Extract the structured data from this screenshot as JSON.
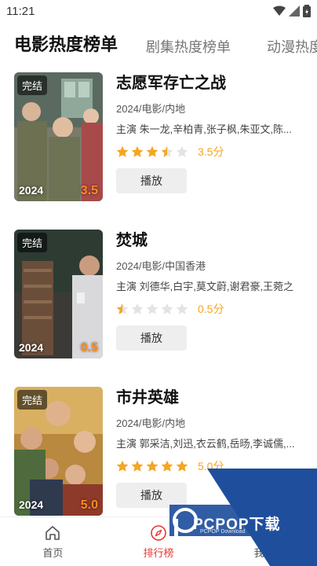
{
  "status_bar": {
    "time": "11:21"
  },
  "tabs": [
    {
      "label": "电影热度榜单",
      "active": true
    },
    {
      "label": "剧集热度榜单",
      "active": false
    },
    {
      "label": "动漫热度榜单",
      "active": false
    }
  ],
  "movies": [
    {
      "title": "志愿军存亡之战",
      "meta": "2024/电影/内地",
      "cast": "主演 朱一龙,辛柏青,张子枫,朱亚文,陈...",
      "rating": 3.5,
      "score_text": "3.5分",
      "poster_badge": "完结",
      "poster_year": "2024",
      "poster_score": "3.5",
      "play_label": "播放"
    },
    {
      "title": "焚城",
      "meta": "2024/电影/中国香港",
      "cast": "主演 刘德华,白宇,莫文蔚,谢君豪,王菀之",
      "rating": 0.5,
      "score_text": "0.5分",
      "poster_badge": "完结",
      "poster_year": "2024",
      "poster_score": "0.5",
      "play_label": "播放"
    },
    {
      "title": "市井英雄",
      "meta": "2024/电影/内地",
      "cast": "主演 郭采洁,刘迅,衣云鹤,岳旸,李诚儒,...",
      "rating": 5.0,
      "score_text": "5.0分",
      "poster_badge": "完结",
      "poster_year": "2024",
      "poster_score": "5.0",
      "play_label": "播放"
    }
  ],
  "bottom_nav": [
    {
      "label": "首页",
      "icon": "home-icon",
      "active": false
    },
    {
      "label": "排行榜",
      "icon": "compass-icon",
      "active": true
    },
    {
      "label": "我的",
      "icon": "person-icon",
      "active": false
    }
  ],
  "watermark": {
    "brand": "PCPOP下载",
    "sub": "PCPOP Download"
  },
  "colors": {
    "star": "#f5a623",
    "star_empty": "#e3e3e3",
    "active_nav": "#e53935",
    "watermark": "#1f4f9c"
  }
}
